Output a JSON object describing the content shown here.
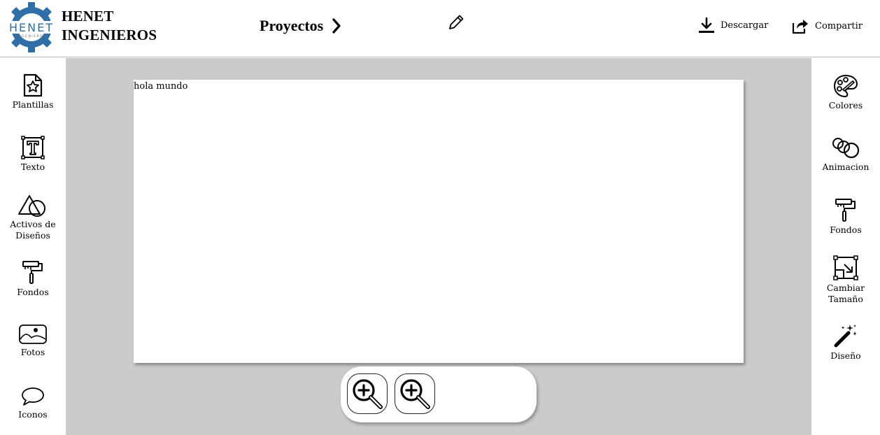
{
  "brand": {
    "line1": "HENET",
    "line2": "INGENIEROS",
    "logo_icon": "gear-logo-icon",
    "logo_text": "HENET",
    "logo_subtext": "INGENIEROS"
  },
  "header": {
    "breadcrumb": "Proyectos",
    "breadcrumb_icon": "chevron-right-icon",
    "edit_icon": "pencil-icon"
  },
  "actions": {
    "download": {
      "label": "Descargar",
      "icon": "download-icon"
    },
    "share": {
      "label": "Compartir",
      "icon": "share-icon"
    }
  },
  "left_sidebar": [
    {
      "label": "Plantillas",
      "icon": "template-icon"
    },
    {
      "label": "Texto",
      "icon": "text-icon"
    },
    {
      "label": "Activos de Diseños",
      "icon": "shapes-icon"
    },
    {
      "label": "Fondos",
      "icon": "paint-roller-icon"
    },
    {
      "label": "Fotos",
      "icon": "photo-icon"
    },
    {
      "label": "Iconos",
      "icon": "speech-bubble-icon"
    }
  ],
  "right_sidebar": [
    {
      "label": "Colores",
      "icon": "palette-icon"
    },
    {
      "label": "Animacion",
      "icon": "rings-icon"
    },
    {
      "label": "Fondos",
      "icon": "paint-roller-icon"
    },
    {
      "label": "Cambiar Tamaño",
      "icon": "resize-icon"
    },
    {
      "label": "Diseño",
      "icon": "magic-wand-icon"
    }
  ],
  "canvas": {
    "text": "hola mundo"
  },
  "zoom": {
    "zoom_in_icon": "zoom-in-icon",
    "zoom_second_icon": "zoom-in-icon"
  },
  "colors": {
    "workspace": "#cbcbcb",
    "logo_blue": "#2f6ea6",
    "logo_gray": "#6b6b6b"
  }
}
